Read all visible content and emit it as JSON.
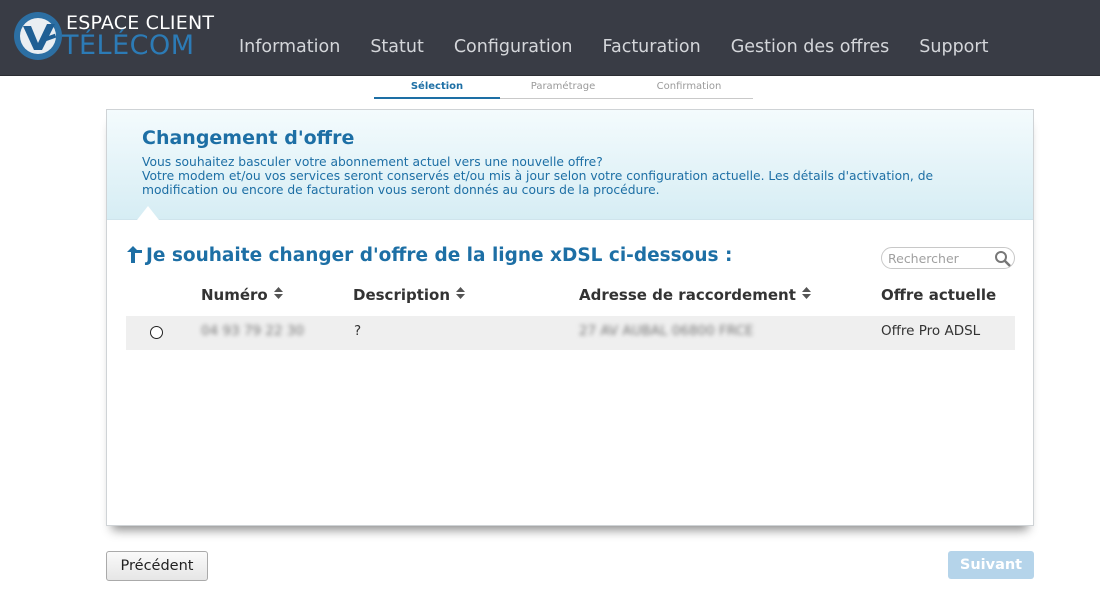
{
  "header": {
    "logo_line1": "ESPACE CLIENT",
    "logo_line2": "TÉLÉCOM",
    "logo_icon": "v-logo-icon",
    "nav": [
      {
        "label": "Information"
      },
      {
        "label": "Statut"
      },
      {
        "label": "Configuration"
      },
      {
        "label": "Facturation"
      },
      {
        "label": "Gestion des offres"
      },
      {
        "label": "Support"
      }
    ]
  },
  "steps": [
    {
      "label": "Sélection",
      "active": true
    },
    {
      "label": "Paramétrage",
      "active": false
    },
    {
      "label": "Confirmation",
      "active": false
    }
  ],
  "panel": {
    "title": "Changement d'offre",
    "desc_line1": "Vous souhaitez basculer votre abonnement actuel vers une nouvelle offre?",
    "desc_line2": "Votre modem et/ou vos services seront conservés et/ou mis à jour selon votre configuration actuelle. Les détails d'activation, de modification ou encore de facturation vous seront donnés au cours de la procédure."
  },
  "section": {
    "title": "Je souhaite changer d'offre de la ligne xDSL ci-dessous :",
    "icon": "back-arrow-icon"
  },
  "search": {
    "placeholder": "Rechercher",
    "icon": "search-icon"
  },
  "table": {
    "columns": [
      {
        "label": "Numéro",
        "sortable": true
      },
      {
        "label": "Description",
        "sortable": true
      },
      {
        "label": "Adresse de raccordement",
        "sortable": true
      },
      {
        "label": "Offre actuelle",
        "sortable": false
      }
    ],
    "rows": [
      {
        "numero": "04 93 79 22 30",
        "description": "?",
        "adresse": "27 AV AUBAL 06800 FRCE",
        "offre": "Offre Pro ADSL",
        "selected": false
      }
    ]
  },
  "buttons": {
    "prev": "Précédent",
    "next": "Suivant"
  },
  "colors": {
    "accent": "#1d6fa5",
    "header_bg": "#393c45",
    "next_disabled": "#b5d4ea"
  }
}
